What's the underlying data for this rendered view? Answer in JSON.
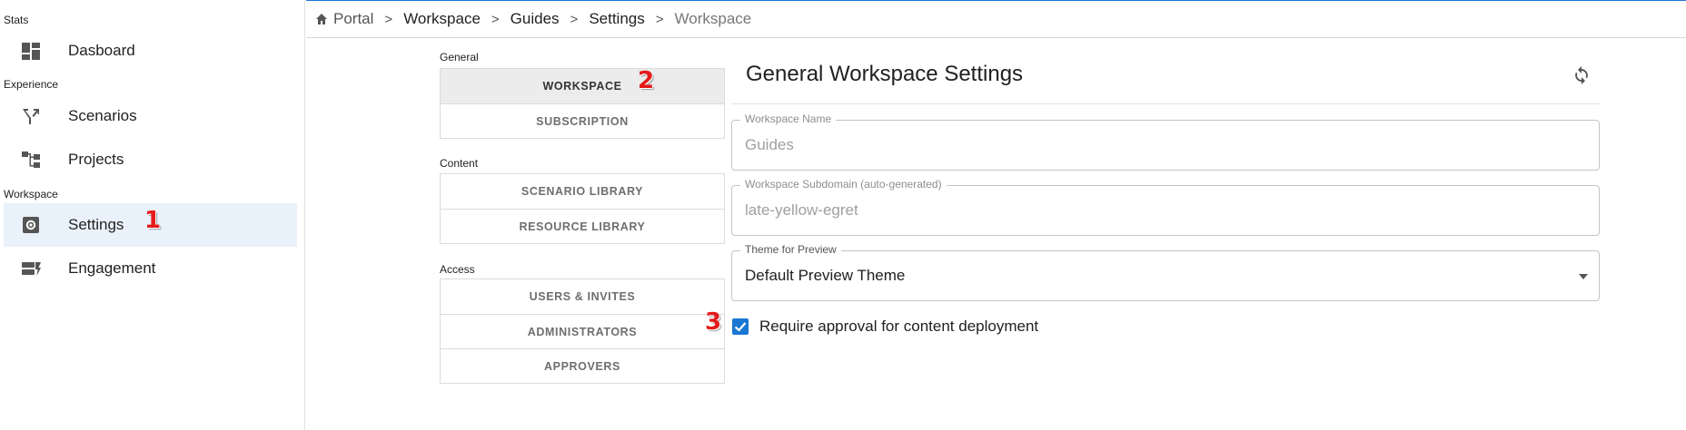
{
  "sidebar": {
    "sections": [
      {
        "label": "Stats"
      },
      {
        "label": "Experience"
      },
      {
        "label": "Workspace"
      }
    ],
    "items": [
      {
        "label": "Dasboard",
        "icon": "dashboard-icon"
      },
      {
        "label": "Scenarios",
        "icon": "scenarios-icon"
      },
      {
        "label": "Projects",
        "icon": "projects-icon"
      },
      {
        "label": "Settings",
        "icon": "settings-icon",
        "active": true
      },
      {
        "label": "Engagement",
        "icon": "engagement-icon"
      }
    ]
  },
  "breadcrumb": [
    "Portal",
    "Workspace",
    "Guides",
    "Settings",
    "Workspace"
  ],
  "settings_nav": {
    "groups": [
      {
        "label": "General",
        "tabs": [
          "WORKSPACE",
          "SUBSCRIPTION"
        ]
      },
      {
        "label": "Content",
        "tabs": [
          "SCENARIO LIBRARY",
          "RESOURCE LIBRARY"
        ]
      },
      {
        "label": "Access",
        "tabs": [
          "USERS & INVITES",
          "ADMINISTRATORS",
          "APPROVERS"
        ]
      }
    ]
  },
  "main": {
    "title": "General Workspace Settings",
    "fields": [
      {
        "label": "Workspace Name",
        "value": "Guides"
      },
      {
        "label": "Workspace Subdomain (auto-generated)",
        "value": "late-yellow-egret"
      },
      {
        "label": "Theme for Preview",
        "value": "Default Preview Theme"
      }
    ],
    "checkbox": {
      "label": "Require approval for content deployment",
      "checked": true
    }
  },
  "markers": [
    "1",
    "2",
    "3"
  ],
  "colors": {
    "accent": "#1976d2",
    "active_bg": "#e9f1fb",
    "marker": "#e41b1b"
  }
}
